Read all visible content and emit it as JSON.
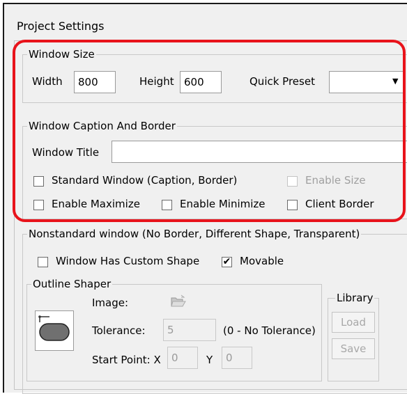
{
  "dialog": {
    "title": "Project Settings"
  },
  "window_size": {
    "legend": "Window Size",
    "width_label": "Width",
    "width_value": "800",
    "height_label": "Height",
    "height_value": "600",
    "quick_preset_label": "Quick Preset",
    "quick_preset_value": ""
  },
  "caption_border": {
    "legend": "Window Caption And Border",
    "window_title_label": "Window Title",
    "window_title_value": "",
    "standard_window": {
      "label": "Standard Window (Caption, Border)",
      "checked": false
    },
    "enable_size": {
      "label": "Enable Size",
      "checked": false,
      "disabled": true
    },
    "enable_maximize": {
      "label": "Enable Maximize",
      "checked": false
    },
    "enable_minimize": {
      "label": "Enable Minimize",
      "checked": false
    },
    "client_border": {
      "label": "Client Border",
      "checked": false
    }
  },
  "nonstandard": {
    "legend": "Nonstandard window (No Border, Different Shape, Transparent)",
    "custom_shape": {
      "label": "Window Has Custom Shape",
      "checked": false
    },
    "movable": {
      "label": "Movable",
      "checked": true,
      "mark": "✔"
    }
  },
  "outline_shaper": {
    "legend": "Outline Shaper",
    "image_label": "Image:",
    "tolerance_label": "Tolerance:",
    "tolerance_value": "5",
    "tolerance_hint": "(0 - No Tolerance)",
    "start_point_label": "Start Point: X",
    "x_value": "0",
    "y_label": "Y",
    "y_value": "0"
  },
  "library": {
    "legend": "Library",
    "load_label": "Load",
    "save_label": "Save"
  },
  "highlight_color": "#e8131b"
}
